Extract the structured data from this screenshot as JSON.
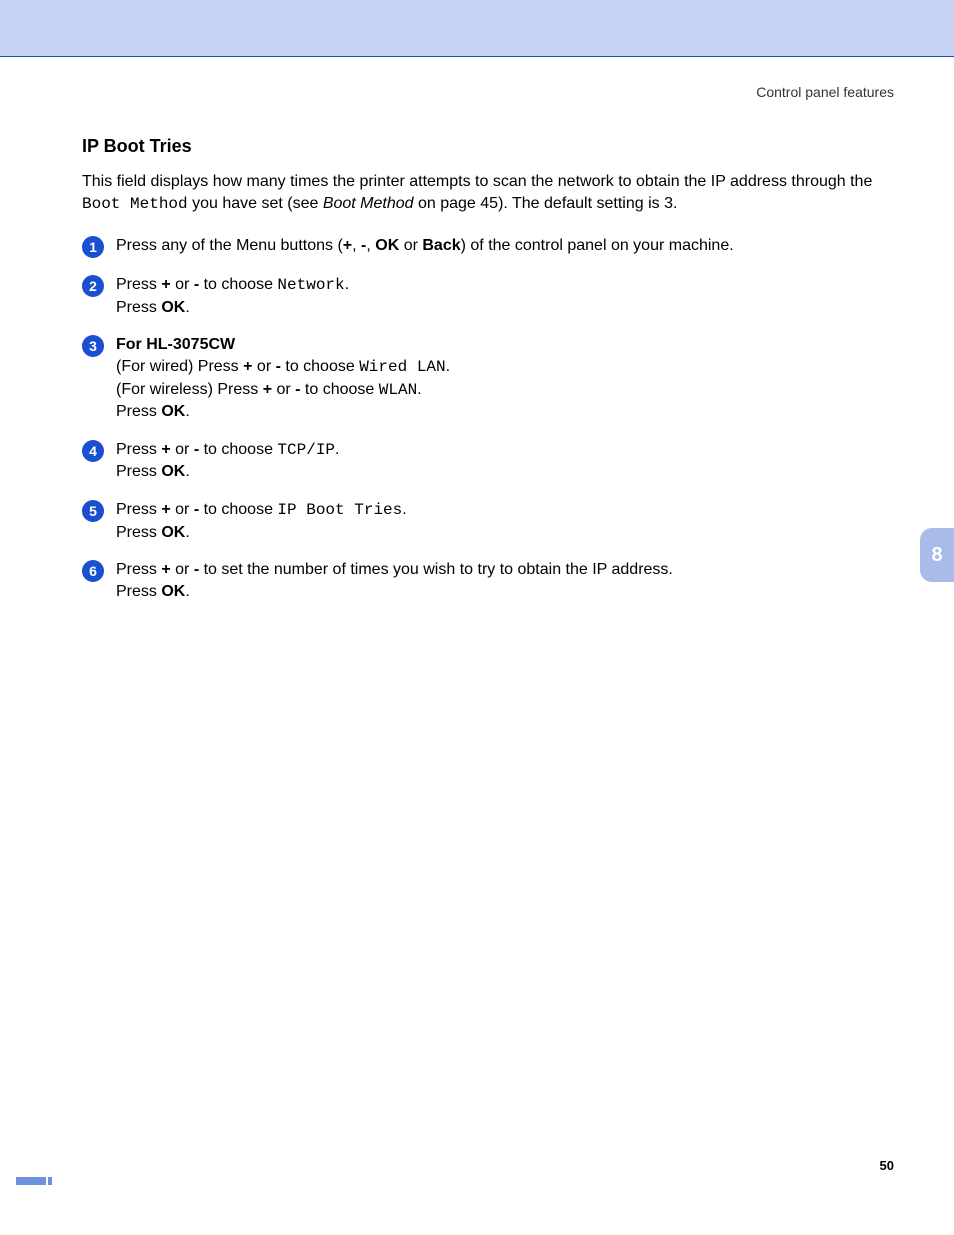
{
  "header_text": "Control panel features",
  "title": "IP Boot Tries",
  "intro_parts": {
    "p1": "This field displays how many times the printer attempts to scan the network to obtain the IP address through the ",
    "boot_method_mono": "Boot Method",
    "p2": " you have set (see ",
    "boot_method_italic": "Boot Method",
    "p3": " on page 45). The default setting is 3."
  },
  "steps": [
    {
      "n": "1",
      "segments": [
        {
          "t": "Press any of the Menu buttons ("
        },
        {
          "t": "+",
          "b": true
        },
        {
          "t": ", "
        },
        {
          "t": "-",
          "b": true
        },
        {
          "t": ", "
        },
        {
          "t": "OK",
          "b": true
        },
        {
          "t": " or "
        },
        {
          "t": "Back",
          "b": true
        },
        {
          "t": ") of the control panel on your machine."
        }
      ]
    },
    {
      "n": "2",
      "segments": [
        {
          "t": "Press "
        },
        {
          "t": "+",
          "b": true
        },
        {
          "t": " or "
        },
        {
          "t": "-",
          "b": true
        },
        {
          "t": " to choose "
        },
        {
          "t": "Network",
          "mono": true
        },
        {
          "t": "."
        },
        {
          "t": "\nPress "
        },
        {
          "t": "OK",
          "b": true
        },
        {
          "t": "."
        }
      ]
    },
    {
      "n": "3",
      "segments": [
        {
          "t": "For HL-3075CW",
          "b": true
        },
        {
          "t": "\n(For wired) Press "
        },
        {
          "t": "+",
          "b": true
        },
        {
          "t": " or "
        },
        {
          "t": "-",
          "b": true
        },
        {
          "t": " to choose "
        },
        {
          "t": "Wired LAN",
          "mono": true
        },
        {
          "t": "."
        },
        {
          "t": "\n(For wireless) Press "
        },
        {
          "t": "+",
          "b": true
        },
        {
          "t": " or "
        },
        {
          "t": "-",
          "b": true
        },
        {
          "t": " to choose "
        },
        {
          "t": "WLAN",
          "mono": true
        },
        {
          "t": "."
        },
        {
          "t": "\nPress "
        },
        {
          "t": "OK",
          "b": true
        },
        {
          "t": "."
        }
      ]
    },
    {
      "n": "4",
      "segments": [
        {
          "t": "Press "
        },
        {
          "t": "+",
          "b": true
        },
        {
          "t": " or "
        },
        {
          "t": "-",
          "b": true
        },
        {
          "t": " to choose "
        },
        {
          "t": "TCP/IP",
          "mono": true
        },
        {
          "t": "."
        },
        {
          "t": "\nPress "
        },
        {
          "t": "OK",
          "b": true
        },
        {
          "t": "."
        }
      ]
    },
    {
      "n": "5",
      "segments": [
        {
          "t": "Press "
        },
        {
          "t": "+",
          "b": true
        },
        {
          "t": " or "
        },
        {
          "t": "-",
          "b": true
        },
        {
          "t": " to choose "
        },
        {
          "t": "IP Boot Tries",
          "mono": true
        },
        {
          "t": "."
        },
        {
          "t": "\nPress "
        },
        {
          "t": "OK",
          "b": true
        },
        {
          "t": "."
        }
      ]
    },
    {
      "n": "6",
      "segments": [
        {
          "t": "Press "
        },
        {
          "t": "+",
          "b": true
        },
        {
          "t": " or "
        },
        {
          "t": "-",
          "b": true
        },
        {
          "t": " to set the number of times you wish to try to obtain the IP address."
        },
        {
          "t": "\nPress "
        },
        {
          "t": "OK",
          "b": true
        },
        {
          "t": "."
        }
      ]
    }
  ],
  "chapter_tab": "8",
  "page_number": "50"
}
